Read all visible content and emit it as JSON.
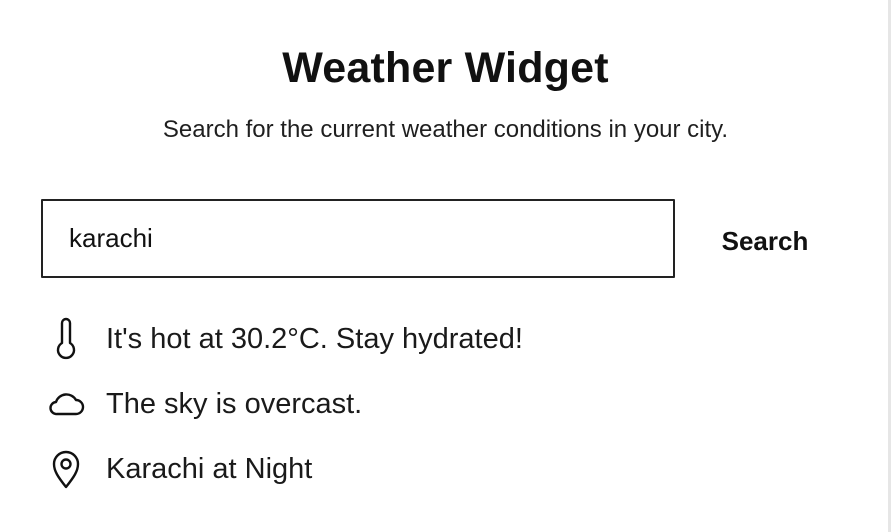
{
  "header": {
    "title": "Weather Widget",
    "subtitle": "Search for the current weather conditions in your city."
  },
  "search": {
    "value": "karachi",
    "placeholder": "",
    "button_label": "Search"
  },
  "results": {
    "temperature": {
      "icon": "thermometer-icon",
      "text": "It's hot at 30.2°C. Stay hydrated!"
    },
    "sky": {
      "icon": "cloud-icon",
      "text": "The sky is overcast."
    },
    "location": {
      "icon": "map-pin-icon",
      "text": "Karachi at Night"
    }
  },
  "colors": {
    "background": "#ffffff",
    "text": "#111111",
    "border": "#222222"
  }
}
